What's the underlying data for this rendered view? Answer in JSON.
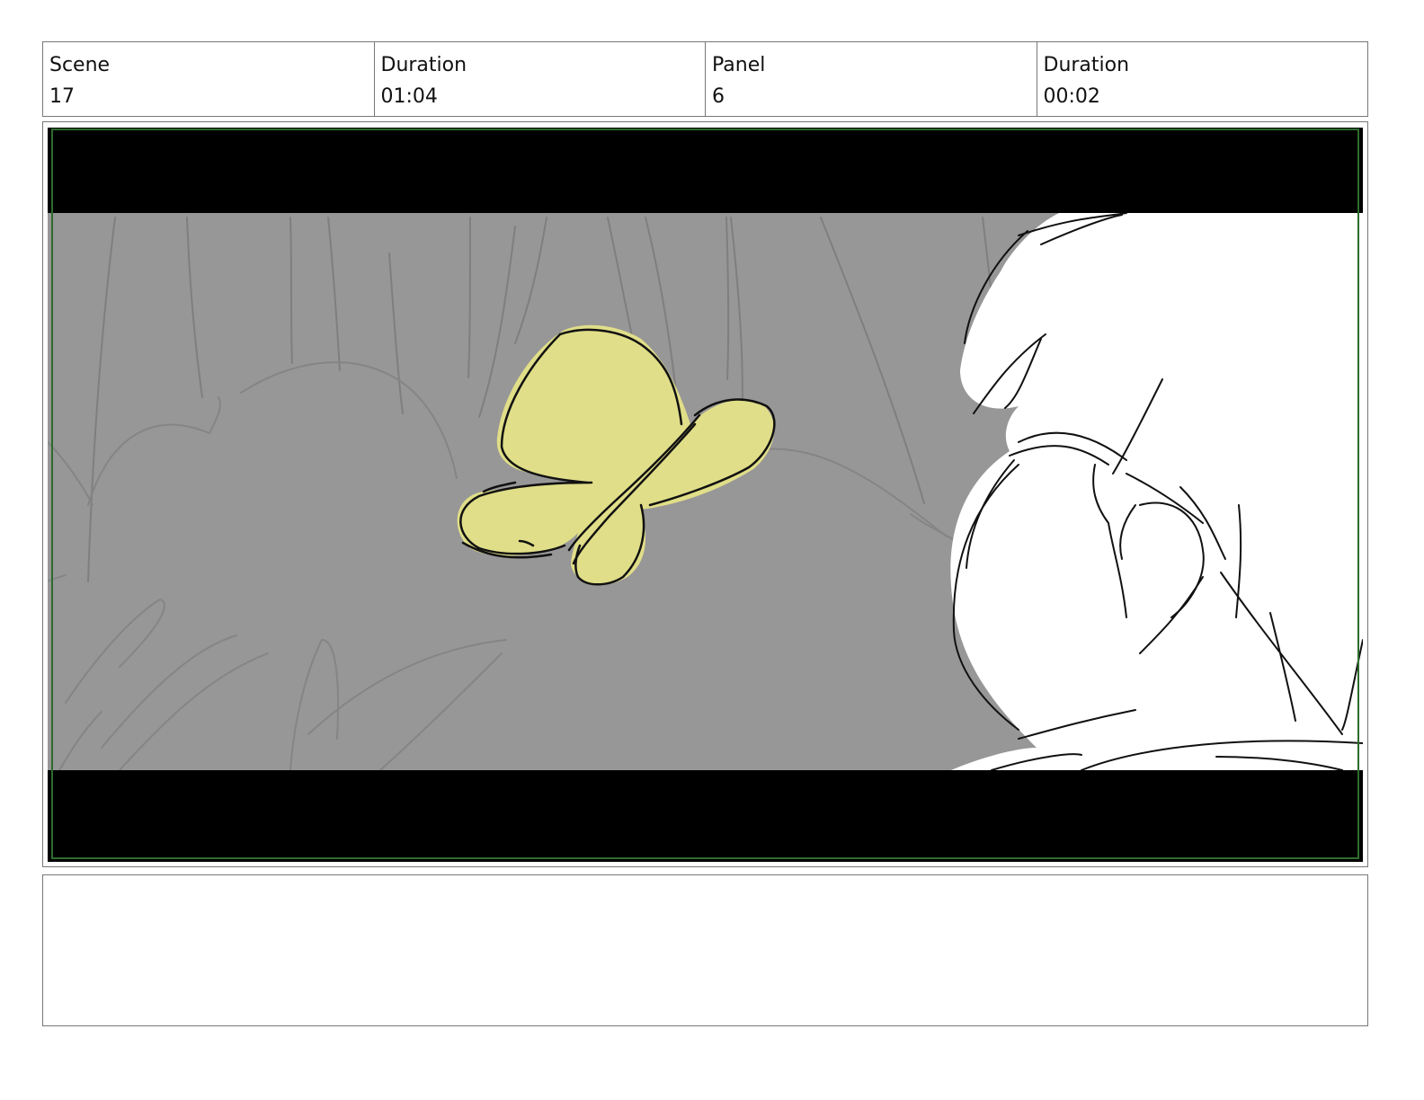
{
  "header": {
    "scene_label": "Scene",
    "scene_value": "17",
    "scene_duration_label": "Duration",
    "scene_duration_value": "01:04",
    "panel_label": "Panel",
    "panel_value": "6",
    "panel_duration_label": "Duration",
    "panel_duration_value": "00:02"
  },
  "panel": {
    "letterbox_color": "#000000",
    "background_color": "#979797",
    "butterfly_color": "#e0de88",
    "safe_frame_color": "#2e6b2e"
  },
  "notes": {
    "text": ""
  }
}
